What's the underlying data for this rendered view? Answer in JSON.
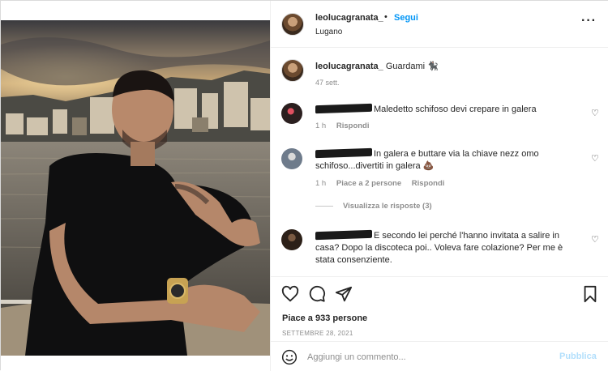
{
  "header": {
    "username": "leolucagranata_",
    "separator": "•",
    "follow_label": "Segui",
    "location": "Lugano",
    "more_icon": "more-horizontal-icon"
  },
  "caption": {
    "username": "leolucagranata_",
    "text": "Guardami 🐈‍⬛",
    "time": "47 sett."
  },
  "comments": [
    {
      "text": "Maledetto schifoso devi crepare in galera",
      "time": "1 h",
      "reply_label": "Rispondi",
      "avatar_color": "#3b2a2a"
    },
    {
      "text": "In galera e buttare via la chiave nezz omo schifoso...divertiti in galera 💩",
      "time": "1 h",
      "likes": "Piace a 2 persone",
      "reply_label": "Rispondi",
      "view_replies": "Visualizza le risposte (3)",
      "avatar_color": "#6e7b8b"
    },
    {
      "text": "E secondo lei perché l'hanno invitata a salire in casa? Dopo la discoteca poi.. Voleva fare colazione? Per me è stata consenziente.",
      "avatar_color": "#2c2018"
    }
  ],
  "actions": {
    "like_icon": "heart-icon",
    "comment_icon": "comment-icon",
    "share_icon": "send-icon",
    "save_icon": "bookmark-icon",
    "likes_text": "Piace a 933 persone",
    "date": "SETTEMBRE 28, 2021"
  },
  "add_comment": {
    "placeholder": "Aggiungi un commento...",
    "publish_label": "Pubblica",
    "emoji_icon": "emoji-icon"
  },
  "colors": {
    "link_blue": "#0095f6",
    "publish_disabled": "#b2dffc",
    "muted": "#8e8e8e"
  }
}
